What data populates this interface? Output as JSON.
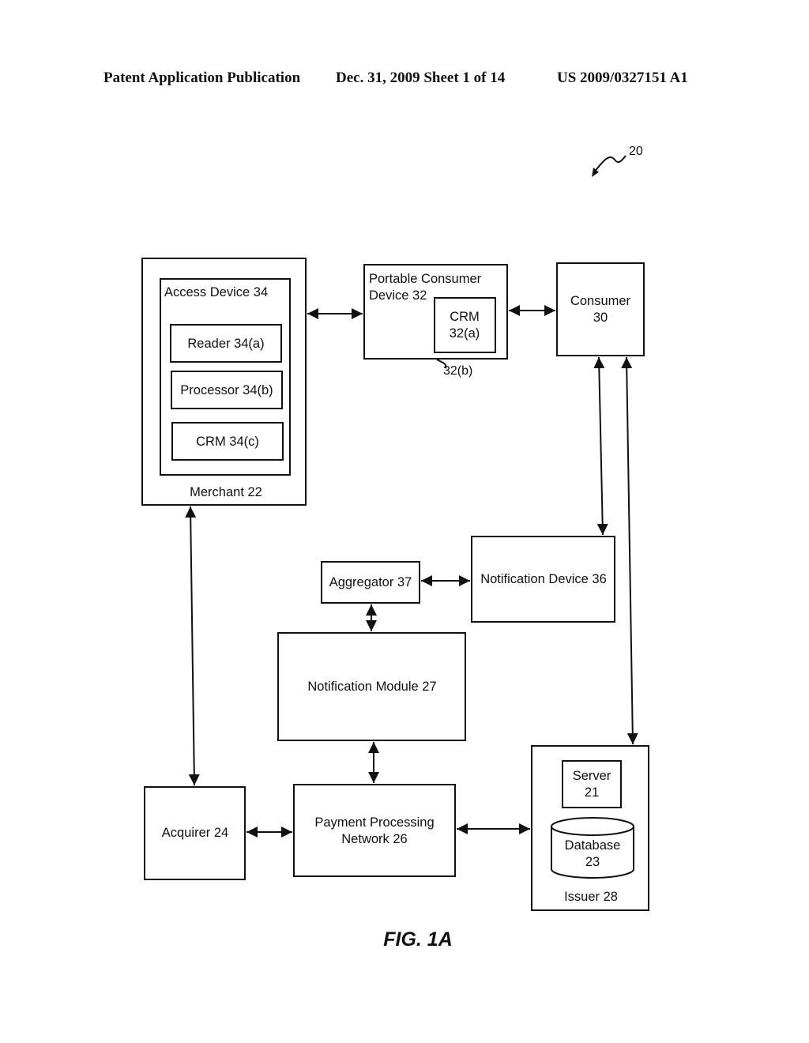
{
  "header": {
    "left": "Patent Application Publication",
    "middle": "Dec. 31, 2009   Sheet 1 of 14",
    "right": "US 2009/0327151 A1"
  },
  "figure": {
    "reference_numeral": "20",
    "caption": "FIG. 1A"
  },
  "blocks": {
    "merchant": "Merchant 22",
    "access_device": "Access Device 34",
    "reader": "Reader 34(a)",
    "processor": "Processor 34(b)",
    "crm_34c": "CRM 34(c)",
    "portable_device_line1": "Portable Consumer",
    "portable_device_line2": "Device 32",
    "crm_32a_line1": "CRM",
    "crm_32a_line2": "32(a)",
    "portable_ref": "32(b)",
    "consumer_line1": "Consumer",
    "consumer_line2": "30",
    "aggregator": "Aggregator 37",
    "notification_device": "Notification Device 36",
    "notification_module": "Notification Module 27",
    "acquirer": "Acquirer 24",
    "ppn_line1": "Payment Processing",
    "ppn_line2": "Network 26",
    "server_line1": "Server",
    "server_line2": "21",
    "database_line1": "Database",
    "database_line2": "23",
    "issuer": "Issuer 28"
  }
}
